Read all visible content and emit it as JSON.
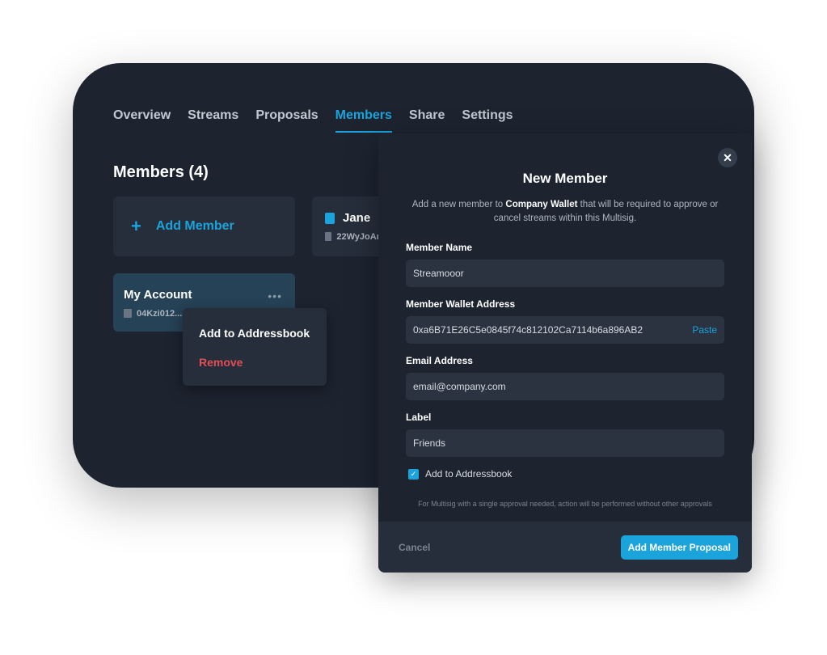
{
  "tabs": [
    "Overview",
    "Streams",
    "Proposals",
    "Members",
    "Share",
    "Settings"
  ],
  "members": {
    "title": "Members (4)",
    "add_label": "Add Member",
    "jane": {
      "name": "Jane",
      "address": "22WyJoAr"
    },
    "my_account": {
      "name": "My Account",
      "address": "04Kzi012..."
    }
  },
  "context_menu": {
    "add": "Add to Addressbook",
    "remove": "Remove"
  },
  "modal": {
    "title": "New Member",
    "desc_pre": "Add a new member to ",
    "desc_bold": "Company Wallet",
    "desc_post": " that will be required to approve or cancel streams within this Multisig.",
    "name_label": "Member Name",
    "name_value": "Streamooor",
    "wallet_label": "Member Wallet Address",
    "wallet_value": "0xa6B71E26C5e0845f74c812102Ca7114b6a896AB2",
    "paste": "Paste",
    "email_label": "Email Address",
    "email_value": "email@company.com",
    "label_label": "Label",
    "label_value": "Friends",
    "checkbox_label": "Add to Addressbook",
    "checkbox_checked": true,
    "note": "For Multisig with a single approval needed, action will be performed without other approvals",
    "cancel": "Cancel",
    "submit": "Add Member Proposal"
  },
  "colors": {
    "accent": "#1ba3dc",
    "danger": "#e04f55"
  }
}
